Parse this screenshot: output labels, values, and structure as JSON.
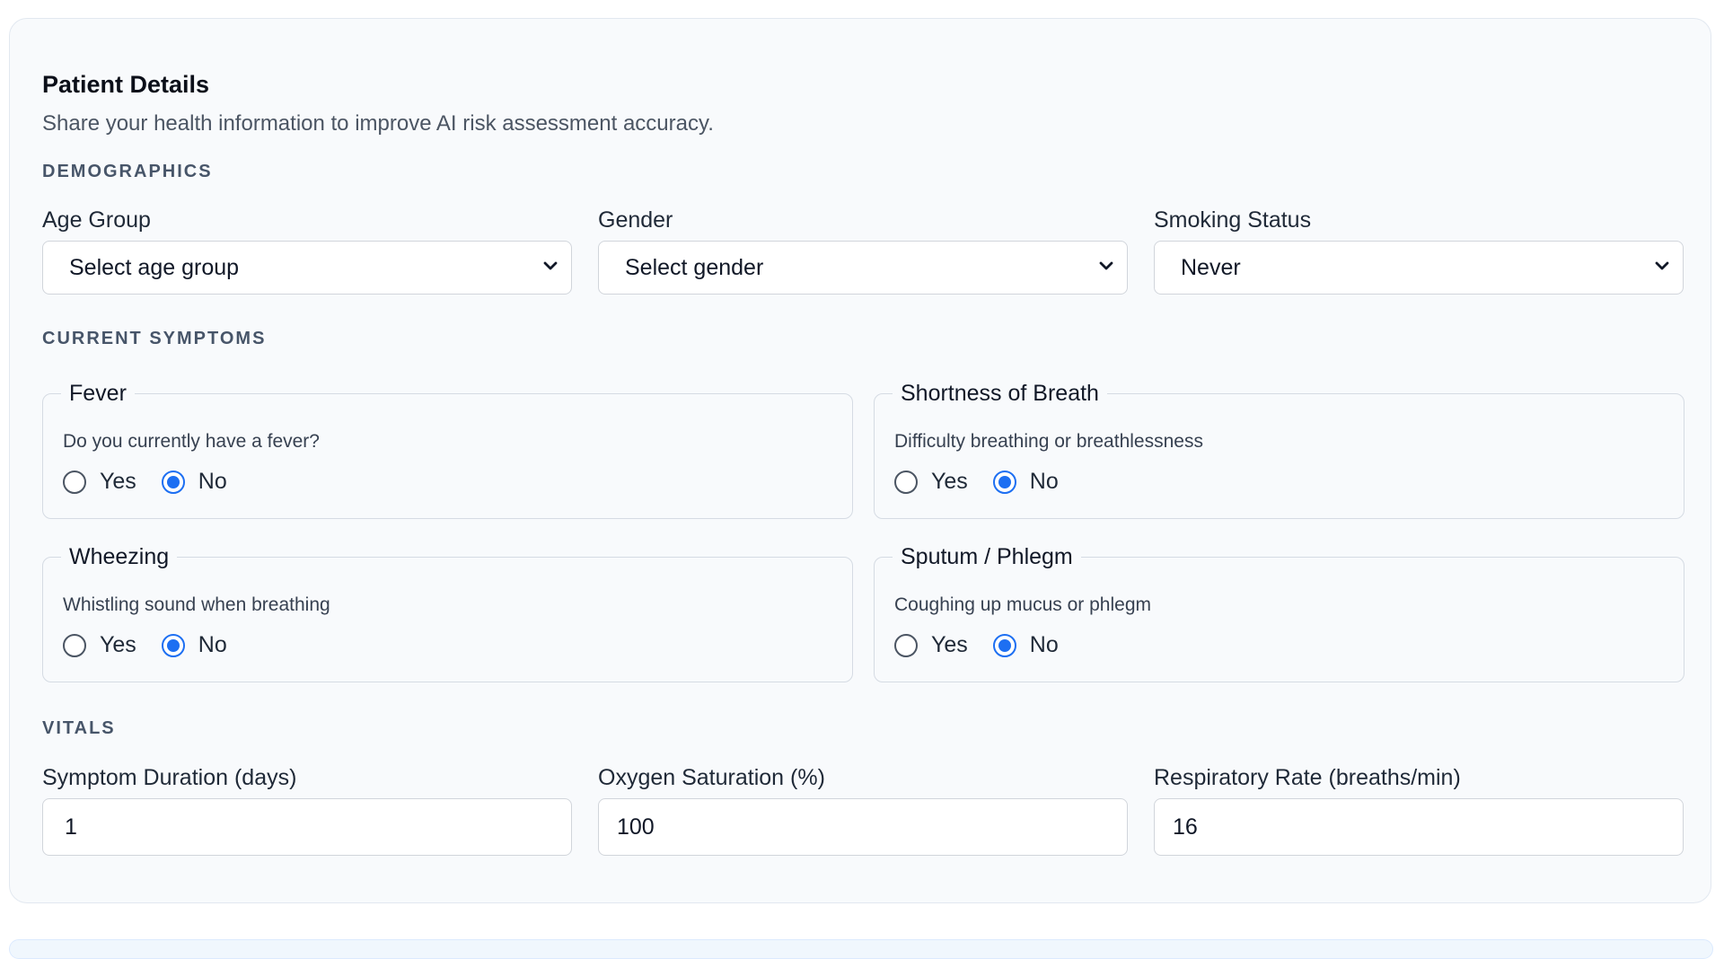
{
  "patient_details": {
    "title": "Patient Details",
    "subtitle": "Share your health information to improve AI risk assessment accuracy."
  },
  "demographics": {
    "section_label": "DEMOGRAPHICS",
    "age_group": {
      "label": "Age Group",
      "value": "Select age group"
    },
    "gender": {
      "label": "Gender",
      "value": "Select gender"
    },
    "smoking_status": {
      "label": "Smoking Status",
      "value": "Never"
    }
  },
  "symptoms": {
    "section_label": "CURRENT SYMPTOMS",
    "items": [
      {
        "legend": "Fever",
        "description": "Do you currently have a fever?",
        "yes_label": "Yes",
        "no_label": "No",
        "selected": "No"
      },
      {
        "legend": "Shortness of Breath",
        "description": "Difficulty breathing or breathlessness",
        "yes_label": "Yes",
        "no_label": "No",
        "selected": "No"
      },
      {
        "legend": "Wheezing",
        "description": "Whistling sound when breathing",
        "yes_label": "Yes",
        "no_label": "No",
        "selected": "No"
      },
      {
        "legend": "Sputum / Phlegm",
        "description": "Coughing up mucus or phlegm",
        "yes_label": "Yes",
        "no_label": "No",
        "selected": "No"
      }
    ]
  },
  "vitals": {
    "section_label": "VITALS",
    "symptom_duration": {
      "label": "Symptom Duration (days)",
      "value": "1"
    },
    "oxygen_saturation": {
      "label": "Oxygen Saturation (%)",
      "value": "100"
    },
    "respiratory_rate": {
      "label": "Respiratory Rate (breaths/min)",
      "value": "16"
    }
  },
  "colors": {
    "accent": "#1d6ff2",
    "card_background": "#f8fafc",
    "border": "#d1d5db",
    "section_label": "#475569"
  },
  "icons": {
    "select_arrow": "chevron-down-icon"
  }
}
